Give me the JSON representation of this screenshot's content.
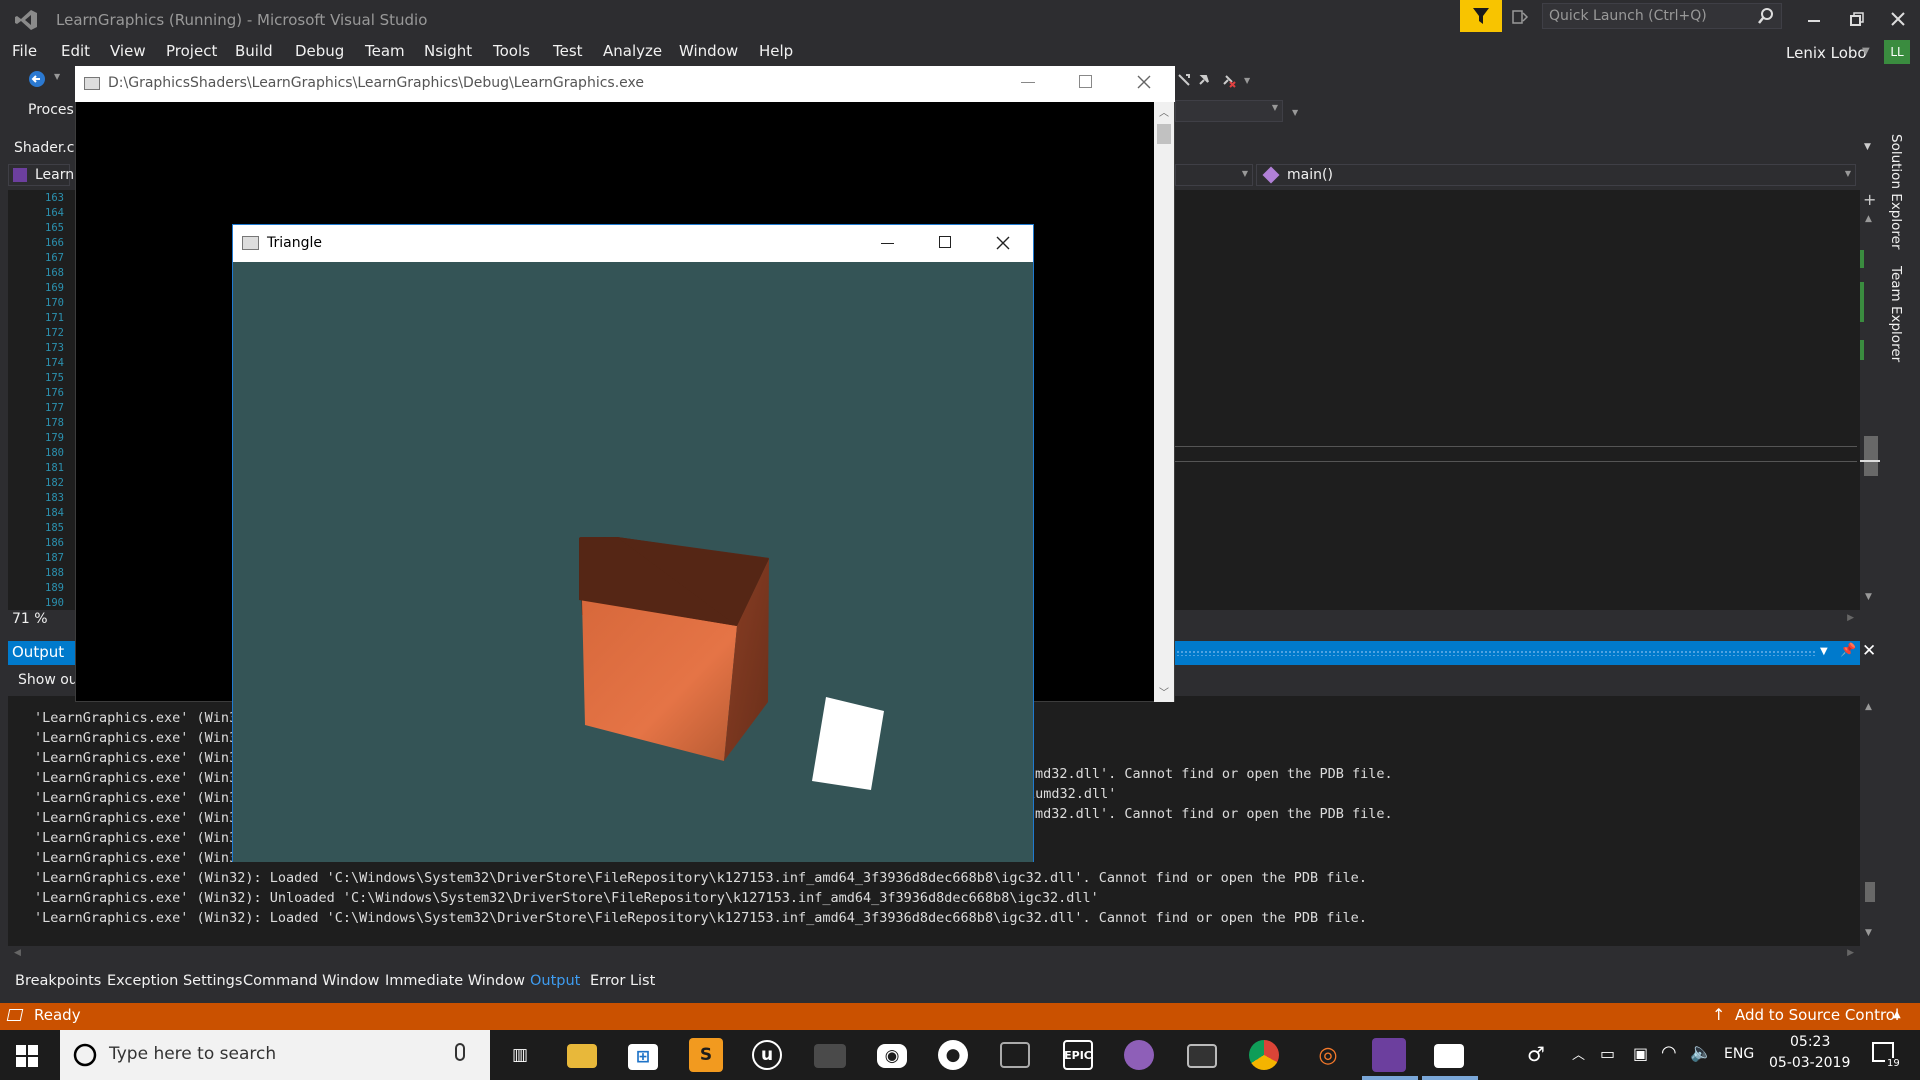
{
  "vs": {
    "window_title": "LearnGraphics (Running) - Microsoft Visual Studio",
    "quick_launch_placeholder": "Quick Launch (Ctrl+Q)",
    "user_name": "Lenix Lobo",
    "user_initials": "LL",
    "menu": [
      "File",
      "Edit",
      "View",
      "Project",
      "Build",
      "Debug",
      "Team",
      "Nsight",
      "Tools",
      "Test",
      "Analyze",
      "Window",
      "Help"
    ],
    "process_label": "Proces",
    "doc_tab": "Shader.cp",
    "nav_project": "Learn",
    "nav_member": "main()",
    "zoom": "71 %",
    "line_numbers": [
      "163",
      "164",
      "165",
      "166",
      "167",
      "168",
      "169",
      "170",
      "171",
      "172",
      "173",
      "174",
      "175",
      "176",
      "177",
      "178",
      "179",
      "180",
      "181",
      "182",
      "183",
      "184",
      "185",
      "186",
      "187",
      "188",
      "189",
      "190"
    ],
    "side_tabs": [
      "Solution Explorer",
      "Team Explorer"
    ]
  },
  "output": {
    "title": "Output",
    "show_output_from": "Show ou",
    "lines": [
      "'LearnGraphics.exe' (Win32",
      "'LearnGraphics.exe' (Win32",
      "'LearnGraphics.exe' (Win32",
      "'LearnGraphics.exe' (Win32",
      "'LearnGraphics.exe' (Win32",
      "'LearnGraphics.exe' (Win32",
      "'LearnGraphics.exe' (Win32",
      "'LearnGraphics.exe' (Win32",
      "'LearnGraphics.exe' (Win32): Loaded 'C:\\Windows\\System32\\DriverStore\\FileRepository\\k127153.inf_amd64_3f3936d8dec668b8\\igc32.dll'. Cannot find or open the PDB file.",
      "'LearnGraphics.exe' (Win32): Unloaded 'C:\\Windows\\System32\\DriverStore\\FileRepository\\k127153.inf_amd64_3f3936d8dec668b8\\igc32.dll'",
      "'LearnGraphics.exe' (Win32): Loaded 'C:\\Windows\\System32\\DriverStore\\FileRepository\\k127153.inf_amd64_3f3936d8dec668b8\\igc32.dll'. Cannot find or open the PDB file."
    ],
    "right_fragments": [
      "md32.dll'. Cannot find or open the PDB file.",
      "iumd32.dll'",
      "md32.dll'. Cannot find or open the PDB file."
    ]
  },
  "bottom_tabs": [
    "Breakpoints",
    "Exception Settings",
    "Command Window",
    "Immediate Window",
    "Output",
    "Error List"
  ],
  "status": {
    "ready": "Ready",
    "source_control": "Add to Source Control"
  },
  "console": {
    "title": "D:\\GraphicsShaders\\LearnGraphics\\LearnGraphics\\Debug\\LearnGraphics.exe"
  },
  "triangle": {
    "title": "Triangle",
    "clear_color": "#345456",
    "cube_color": "#e0703f",
    "light_color": "#ffffff"
  },
  "taskbar": {
    "search_placeholder": "Type here to search",
    "lang": "ENG",
    "time": "05:23",
    "date": "05-03-2019",
    "notifications": "19"
  },
  "colors": {
    "accent": "#007acc",
    "status": "#ca5100",
    "filter": "#f8c400"
  }
}
